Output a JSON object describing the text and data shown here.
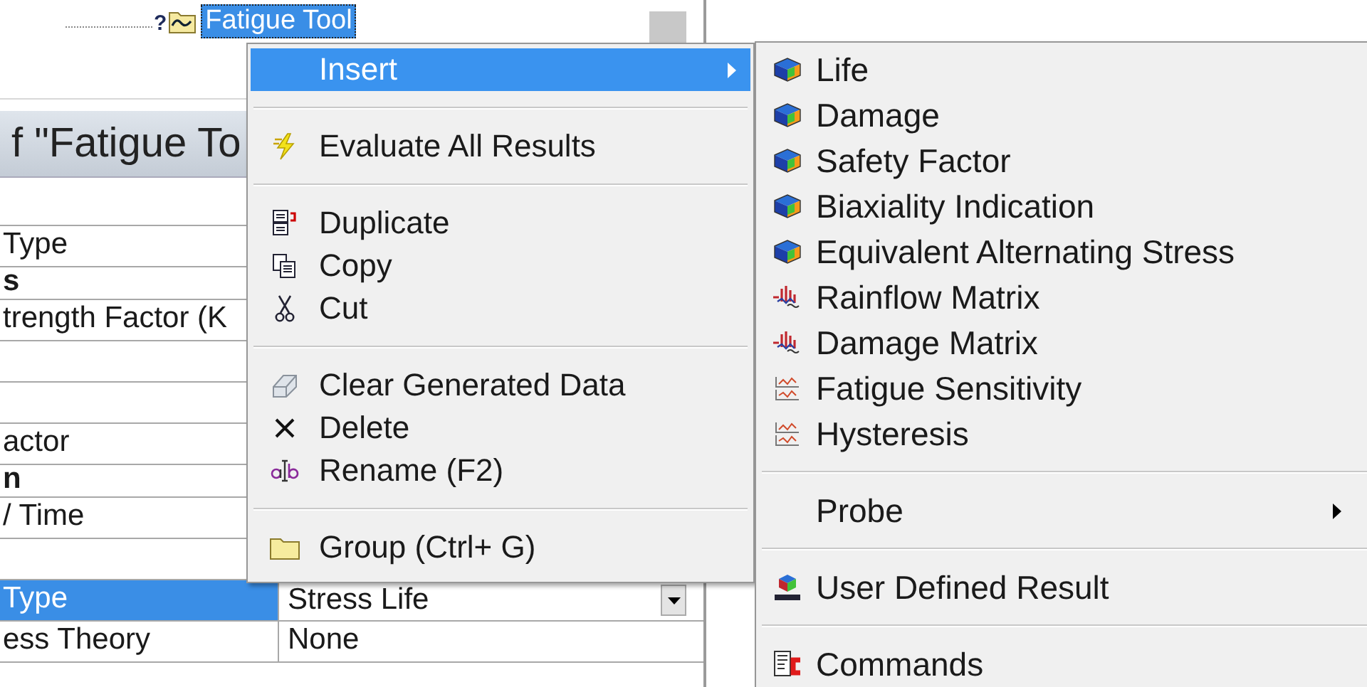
{
  "tree": {
    "item": {
      "label": "Fatigue Tool",
      "status": "?",
      "selected": true
    }
  },
  "details": {
    "title": "f \"Fatigue To",
    "rows": [
      {
        "kind": "row",
        "property": "",
        "value": "",
        "selected": false
      },
      {
        "kind": "row",
        "property": "Type",
        "value": "",
        "selected": false
      },
      {
        "kind": "header",
        "property": "s",
        "value": "",
        "selected": false
      },
      {
        "kind": "row",
        "property": "trength Factor (K",
        "value": "",
        "selected": false
      },
      {
        "kind": "row",
        "property": "",
        "value": "",
        "selected": false
      },
      {
        "kind": "row",
        "property": "",
        "value": "",
        "selected": false
      },
      {
        "kind": "row",
        "property": "actor",
        "value": "",
        "selected": false
      },
      {
        "kind": "header",
        "property": "n",
        "value": "",
        "selected": false
      },
      {
        "kind": "row",
        "property": "/ Time",
        "value": "",
        "selected": false
      },
      {
        "kind": "row",
        "property": "",
        "value": "",
        "selected": false
      },
      {
        "kind": "dropdown",
        "property": "Type",
        "value": "Stress Life",
        "selected": true
      },
      {
        "kind": "row",
        "property": "ess Theory",
        "value": "None",
        "selected": false
      }
    ]
  },
  "context_menu": {
    "items": [
      {
        "label": "Insert",
        "kind": "submenu",
        "selected": true,
        "separator_before": false
      },
      {
        "label": "Evaluate All Results",
        "kind": "evaluate",
        "selected": false,
        "separator_before": true
      },
      {
        "label": "Duplicate",
        "kind": "duplicate",
        "selected": false,
        "separator_before": true
      },
      {
        "label": "Copy",
        "kind": "copy",
        "selected": false,
        "separator_before": false
      },
      {
        "label": "Cut",
        "kind": "cut",
        "selected": false,
        "separator_before": false
      },
      {
        "label": "Clear Generated Data",
        "kind": "clear",
        "selected": false,
        "separator_before": true
      },
      {
        "label": "Delete",
        "kind": "delete",
        "selected": false,
        "separator_before": false
      },
      {
        "label": "Rename (F2)",
        "kind": "rename",
        "selected": false,
        "separator_before": false
      },
      {
        "label": "Group (Ctrl+ G)",
        "kind": "group",
        "selected": false,
        "separator_before": true
      }
    ]
  },
  "submenu": {
    "items": [
      {
        "label": "Life",
        "kind": "result",
        "selected": false,
        "separator_before": false
      },
      {
        "label": "Damage",
        "kind": "result",
        "selected": false,
        "separator_before": false
      },
      {
        "label": "Safety Factor",
        "kind": "result",
        "selected": false,
        "separator_before": false
      },
      {
        "label": "Biaxiality Indication",
        "kind": "result",
        "selected": false,
        "separator_before": false
      },
      {
        "label": "Equivalent Alternating Stress",
        "kind": "result",
        "selected": false,
        "separator_before": false
      },
      {
        "label": "Rainflow Matrix",
        "kind": "matrix",
        "selected": false,
        "separator_before": false
      },
      {
        "label": "Damage Matrix",
        "kind": "matrix",
        "selected": false,
        "separator_before": false
      },
      {
        "label": "Fatigue Sensitivity",
        "kind": "chart",
        "selected": false,
        "separator_before": false
      },
      {
        "label": "Hysteresis",
        "kind": "chart",
        "selected": false,
        "separator_before": false
      },
      {
        "label": "Probe",
        "kind": "submenu",
        "selected": false,
        "separator_before": true
      },
      {
        "label": "User Defined Result",
        "kind": "user",
        "selected": false,
        "separator_before": true
      },
      {
        "label": "Commands",
        "kind": "command",
        "selected": false,
        "separator_before": true
      }
    ]
  }
}
